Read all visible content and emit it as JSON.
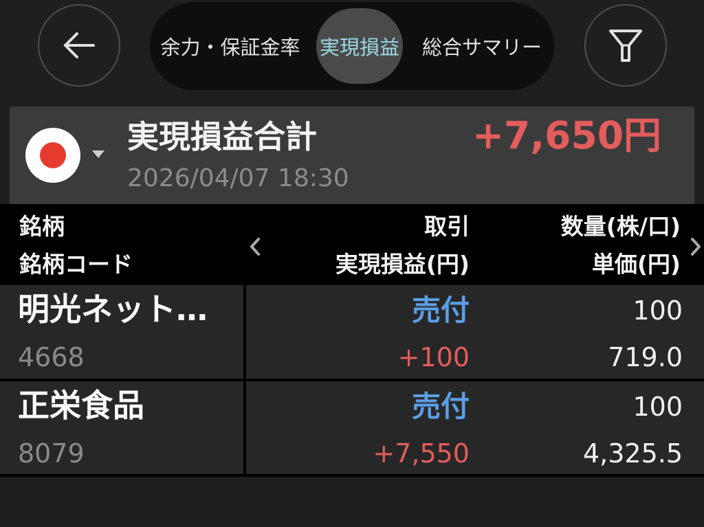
{
  "header": {
    "back_icon": "arrow-left-icon",
    "filter_icon": "filter-icon",
    "tabs": [
      {
        "label": "余力・保証金率",
        "selected": false
      },
      {
        "label": "実現損益",
        "selected": true
      },
      {
        "label": "総合サマリー",
        "selected": false
      }
    ]
  },
  "summary": {
    "market_icon": "japan-flag-icon",
    "dropdown_icon": "caret-down-icon",
    "title": "実現損益合計",
    "timestamp": "2026/04/07 18:30",
    "total": "+7,650円"
  },
  "table": {
    "prev_icon": "chevron-left-icon",
    "next_icon": "chevron-right-icon",
    "columns": {
      "name": "銘柄",
      "code": "銘柄コード",
      "trade": "取引",
      "pnl": "実現損益(円)",
      "qty": "数量(株/口)",
      "price": "単価(円)"
    },
    "rows": [
      {
        "name": "明光ネット…",
        "code": "4668",
        "trade": "売付",
        "pnl": "+100",
        "qty": "100",
        "price": "719.0"
      },
      {
        "name": "正栄食品",
        "code": "8079",
        "trade": "売付",
        "pnl": "+7,550",
        "qty": "100",
        "price": "4,325.5"
      }
    ]
  },
  "colors": {
    "accent_red": "#e35d5d",
    "trade_blue": "#5a9fe6",
    "selected_tab_text": "#9cd9e4",
    "flag_red": "#e63a2e"
  }
}
